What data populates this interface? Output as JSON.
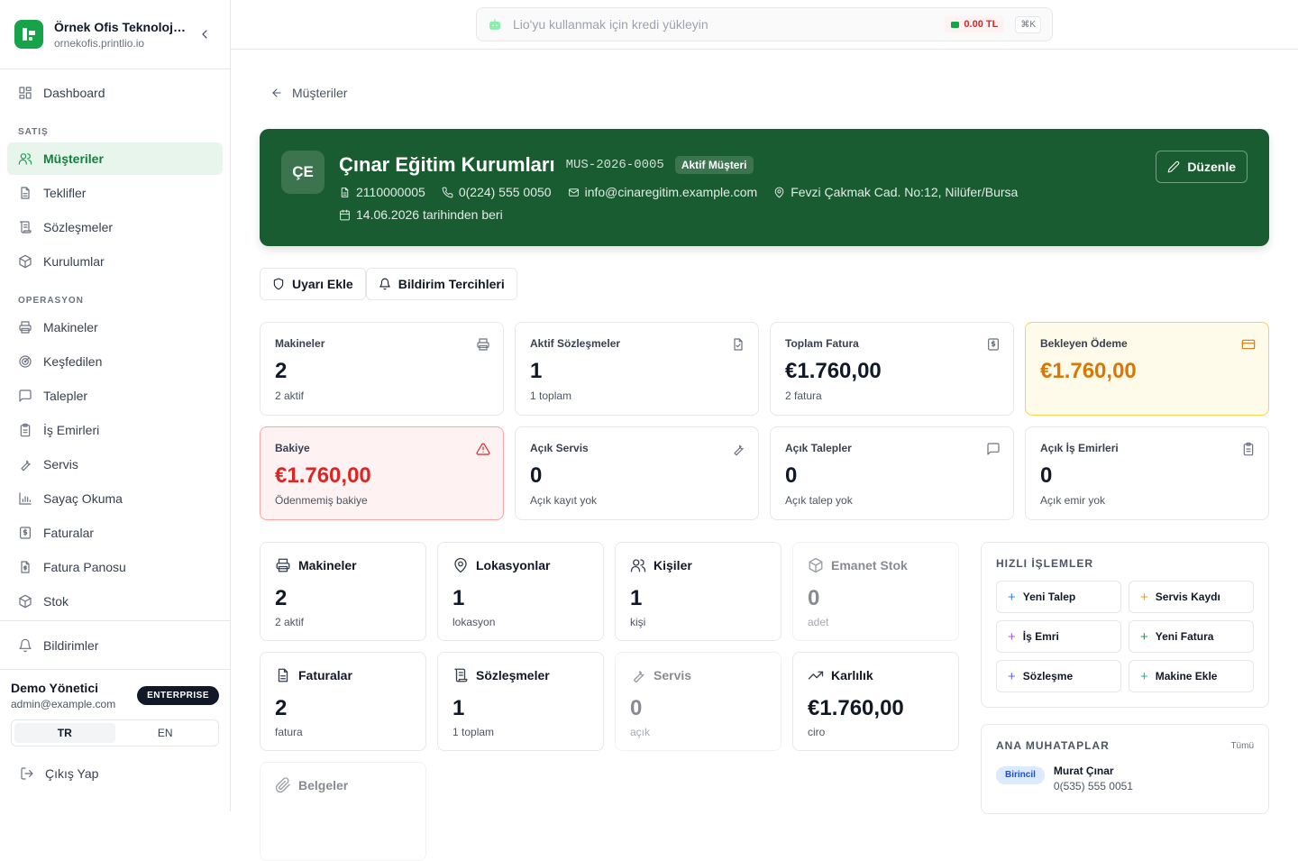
{
  "brand": {
    "name": "Örnek Ofis Teknolojileri",
    "domain": "ornekofis.printlio.io"
  },
  "nav": {
    "dashboard": "Dashboard",
    "section_sales": "SATIŞ",
    "sales": [
      "Müşteriler",
      "Teklifler",
      "Sözleşmeler",
      "Kurulumlar"
    ],
    "section_ops": "OPERASYON",
    "ops": [
      "Makineler",
      "Keşfedilen",
      "Talepler",
      "İş Emirleri",
      "Servis",
      "Sayaç Okuma",
      "Faturalar",
      "Fatura Panosu",
      "Stok"
    ],
    "active": "Müşteriler"
  },
  "notifications_label": "Bildirimler",
  "user": {
    "name": "Demo Yönetici",
    "email": "admin@example.com",
    "plan": "ENTERPRISE"
  },
  "lang": {
    "tr": "TR",
    "en": "EN",
    "selected": "TR"
  },
  "logout_label": "Çıkış Yap",
  "command_bar": {
    "placeholder": "Lio'yu kullanmak için kredi yükleyin",
    "credit": "0.00 TL",
    "shortcut": "⌘K"
  },
  "back_label": "Müşteriler",
  "customer": {
    "initials": "ÇE",
    "name": "Çınar Eğitim Kurumları",
    "code": "MUS-2026-0005",
    "status": "Aktif Müşteri",
    "tax_no": "2110000005",
    "phone": "0(224) 555 0050",
    "email": "info@cinaregitim.example.com",
    "address": "Fevzi Çakmak Cad. No:12, Nilüfer/Bursa",
    "since": "14.06.2026 tarihinden beri",
    "edit_label": "Düzenle"
  },
  "actions": {
    "alert": "Uyarı Ekle",
    "notify": "Bildirim Tercihleri"
  },
  "stats": [
    {
      "label": "Makineler",
      "value": "2",
      "sub": "2 aktif",
      "icon": "printer-icon"
    },
    {
      "label": "Aktif Sözleşmeler",
      "value": "1",
      "sub": "1 toplam",
      "icon": "file-check-icon"
    },
    {
      "label": "Toplam Fatura",
      "value": "€1.760,00",
      "sub": "2 fatura",
      "icon": "receipt-icon"
    },
    {
      "label": "Bekleyen Ödeme",
      "value": "€1.760,00",
      "sub": "",
      "icon": "credit-card-icon",
      "accent": "#d97706"
    },
    {
      "label": "Bakiye",
      "value": "€1.760,00",
      "sub": "Ödenmemiş bakiye",
      "icon": "alert-triangle-icon",
      "accent": "#dc2626"
    },
    {
      "label": "Açık Servis",
      "value": "0",
      "sub": "Açık kayıt yok",
      "icon": "wrench-icon"
    },
    {
      "label": "Açık Talepler",
      "value": "0",
      "sub": "Açık talep yok",
      "icon": "message-icon"
    },
    {
      "label": "Açık İş Emirleri",
      "value": "0",
      "sub": "Açık emir yok",
      "icon": "clipboard-icon"
    }
  ],
  "tiles": [
    {
      "title": "Makineler",
      "value": "2",
      "sub": "2 aktif",
      "icon": "printer-icon"
    },
    {
      "title": "Lokasyonlar",
      "value": "1",
      "sub": "lokasyon",
      "icon": "map-pin-icon"
    },
    {
      "title": "Kişiler",
      "value": "1",
      "sub": "kişi",
      "icon": "users-icon"
    },
    {
      "title": "Emanet Stok",
      "value": "0",
      "sub": "adet",
      "icon": "package-icon"
    },
    {
      "title": "Faturalar",
      "value": "2",
      "sub": "fatura",
      "icon": "file-text-icon"
    },
    {
      "title": "Sözleşmeler",
      "value": "1",
      "sub": "1 toplam",
      "icon": "scroll-icon"
    },
    {
      "title": "Servis",
      "value": "0",
      "sub": "açık",
      "icon": "wrench-icon"
    },
    {
      "title": "Karlılık",
      "value": "€1.760,00",
      "sub": "ciro",
      "icon": "trending-up-icon"
    },
    {
      "title": "Belgeler",
      "value": "",
      "sub": "",
      "icon": "paperclip-icon"
    }
  ],
  "quick": {
    "title": "HIZLI İŞLEMLER",
    "items": [
      {
        "label": "Yeni Talep",
        "color": "#3b82f6"
      },
      {
        "label": "Servis Kaydı",
        "color": "#f59e0b"
      },
      {
        "label": "İş Emri",
        "color": "#a855f7"
      },
      {
        "label": "Yeni Fatura",
        "color": "#16a34a"
      },
      {
        "label": "Sözleşme",
        "color": "#6366f1"
      },
      {
        "label": "Makine Ekle",
        "color": "#14b8a6"
      }
    ]
  },
  "contacts": {
    "title": "ANA MUHATAPLAR",
    "all_label": "Tümü",
    "primary_badge": "Birincil",
    "name": "Murat Çınar",
    "phone": "0(535) 555 0051"
  }
}
